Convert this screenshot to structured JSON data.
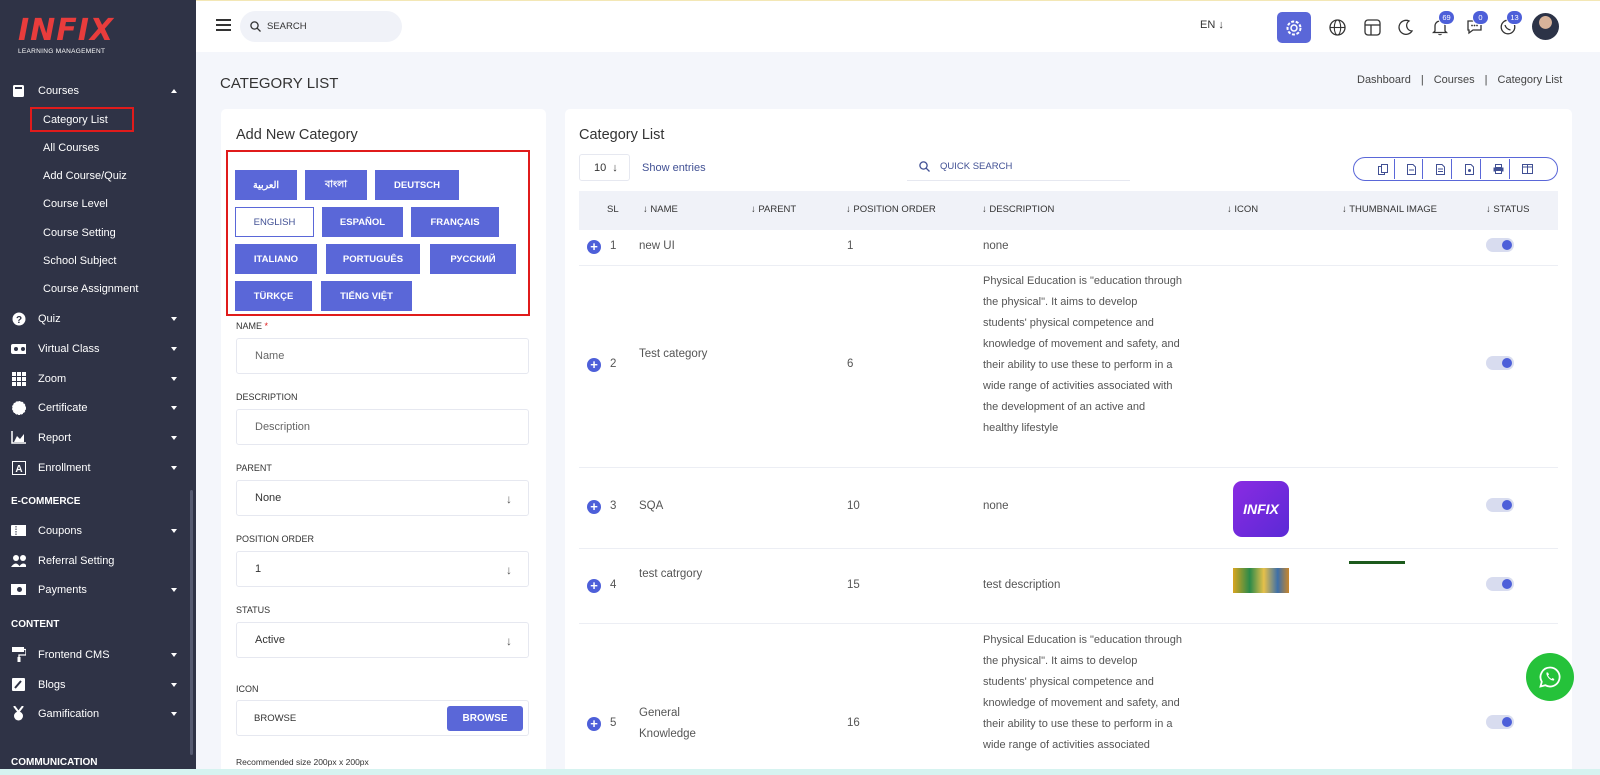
{
  "app": {
    "logo_text": "INFIX",
    "logo_sub": "LEARNING MANAGEMENT"
  },
  "sidebar": {
    "courses": {
      "label": "Courses",
      "sub": [
        "Category List",
        "All Courses",
        "Add Course/Quiz",
        "Course Level",
        "Course Setting",
        "School Subject",
        "Course Assignment"
      ]
    },
    "groups": [
      {
        "label": "Quiz",
        "icon": "question-circle-icon"
      },
      {
        "label": "Virtual Class",
        "icon": "vr-headset-icon"
      },
      {
        "label": "Zoom",
        "icon": "grid-icon"
      },
      {
        "label": "Certificate",
        "icon": "certificate-icon"
      },
      {
        "label": "Report",
        "icon": "chart-area-icon"
      },
      {
        "label": "Enrollment",
        "icon": "enrollment-icon"
      }
    ],
    "ecommerce": {
      "label": "E-COMMERCE",
      "items": [
        {
          "label": "Coupons",
          "icon": "coupon-icon"
        },
        {
          "label": "Referral Setting",
          "icon": "users-icon"
        },
        {
          "label": "Payments",
          "icon": "money-icon"
        }
      ]
    },
    "content": {
      "label": "CONTENT",
      "items": [
        {
          "label": "Frontend CMS",
          "icon": "paint-roller-icon"
        },
        {
          "label": "Blogs",
          "icon": "edit-icon"
        },
        {
          "label": "Gamification",
          "icon": "medal-icon"
        }
      ]
    },
    "communication": {
      "label": "COMMUNICATION"
    }
  },
  "topbar": {
    "search_placeholder": "SEARCH",
    "language": "EN",
    "badges": {
      "notifications": "69",
      "messages": "0",
      "whatsapp": "13"
    }
  },
  "page": {
    "title": "CATEGORY LIST",
    "breadcrumb": [
      "Dashboard",
      "Courses",
      "Category List"
    ]
  },
  "form": {
    "title": "Add New Category",
    "languages": [
      "العربية",
      "বাংলা",
      "DEUTSCH",
      "ENGLISH",
      "ESPAÑOL",
      "FRANÇAIS",
      "ITALIANO",
      "PORTUGUÊS",
      "РУССКИЙ",
      "TÜRKÇE",
      "TIẾNG VIỆT"
    ],
    "active_language": "ENGLISH",
    "name_label": "NAME",
    "name_placeholder": "Name",
    "description_label": "DESCRIPTION",
    "description_placeholder": "Description",
    "parent_label": "PARENT",
    "parent_value": "None",
    "position_label": "POSITION ORDER",
    "position_value": "1",
    "status_label": "STATUS",
    "status_value": "Active",
    "icon_label": "ICON",
    "icon_browse_text": "BROWSE",
    "icon_browse_button": "BROWSE",
    "icon_hint": "Recommended size 200px x 200px"
  },
  "list": {
    "title": "Category List",
    "entries_value": "10",
    "entries_label": "Show entries",
    "search_placeholder": "QUICK SEARCH",
    "export_icons": [
      "copy-icon",
      "csv-icon",
      "excel-icon",
      "pdf-icon",
      "print-icon",
      "columns-icon"
    ],
    "columns": [
      "SL",
      "NAME",
      "PARENT",
      "POSITION ORDER",
      "DESCRIPTION",
      "ICON",
      "THUMBNAIL IMAGE",
      "STATUS"
    ],
    "rows": [
      {
        "sl": "1",
        "name": "new UI",
        "parent": "",
        "position": "1",
        "description": "none",
        "status": true
      },
      {
        "sl": "2",
        "name": "Test category",
        "parent": "",
        "position": "6",
        "description": "Physical Education is \"education through the physical\". It aims to develop students' physical competence and knowledge of movement and safety, and their ability to use these to perform in a wide range of activities associated with the development of an active and healthy lifestyle",
        "status": true
      },
      {
        "sl": "3",
        "name": "SQA",
        "parent": "",
        "position": "10",
        "description": "none",
        "icon_text": "INFIX",
        "status": true
      },
      {
        "sl": "4",
        "name": "test catrgory",
        "parent": "",
        "position": "15",
        "description": "test description",
        "status": true
      },
      {
        "sl": "5",
        "name": "General Knowledge",
        "parent": "",
        "position": "16",
        "description": "Physical Education is \"education through the physical\". It aims to develop students' physical competence and knowledge of movement and safety, and their ability to use these to perform in a wide range of activities associated",
        "status": true
      }
    ]
  },
  "colors": {
    "sidebar_bg": "#2f3346",
    "accent": "#5a67d8",
    "highlight": "#e01b1b",
    "whatsapp": "#25c23a"
  }
}
